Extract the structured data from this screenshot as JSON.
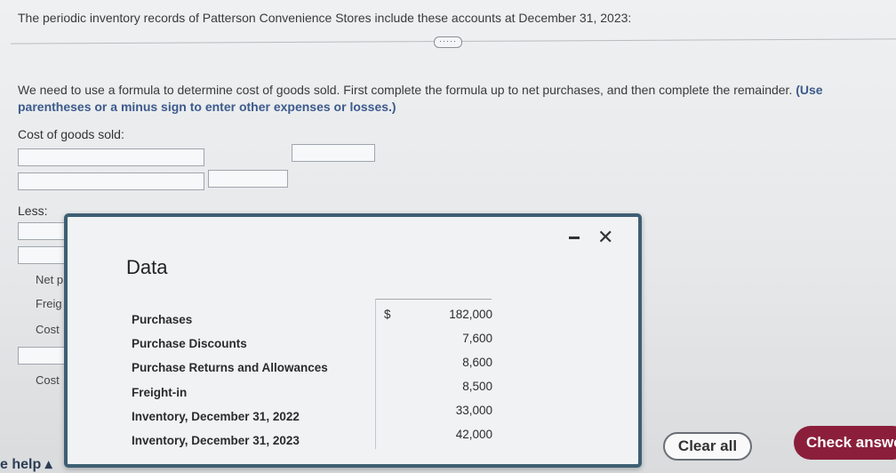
{
  "question": {
    "intro": "The periodic inventory records of Patterson Convenience Stores include these accounts at December 31, 2023:",
    "expand_label": "·····",
    "instructions_plain": "We need to use a formula to determine cost of goods sold. First complete the formula up to net purchases, and then complete the remainder.",
    "instructions_bold": "(Use parentheses or a minus sign to enter other expenses or losses.)"
  },
  "form": {
    "cogs_label": "Cost of goods sold:",
    "less_label": "Less:",
    "partial_labels": [
      "Net p",
      "Freig",
      "Cost",
      "Cost"
    ]
  },
  "dialog": {
    "title": "Data",
    "minimize_symbol": "–",
    "close_symbol": "✕",
    "currency": "$",
    "rows": [
      {
        "label": "Purchases",
        "value": "182,000"
      },
      {
        "label": "Purchase Discounts",
        "value": "7,600"
      },
      {
        "label": "Purchase Returns and Allowances",
        "value": "8,600"
      },
      {
        "label": "Freight-in",
        "value": "8,500"
      },
      {
        "label": "Inventory, December 31, 2022",
        "value": "33,000"
      },
      {
        "label": "Inventory, December 31, 2023",
        "value": "42,000"
      }
    ]
  },
  "footer": {
    "help_label": "e help ▴",
    "clear_label": "Clear all",
    "check_label": "Check answe"
  }
}
